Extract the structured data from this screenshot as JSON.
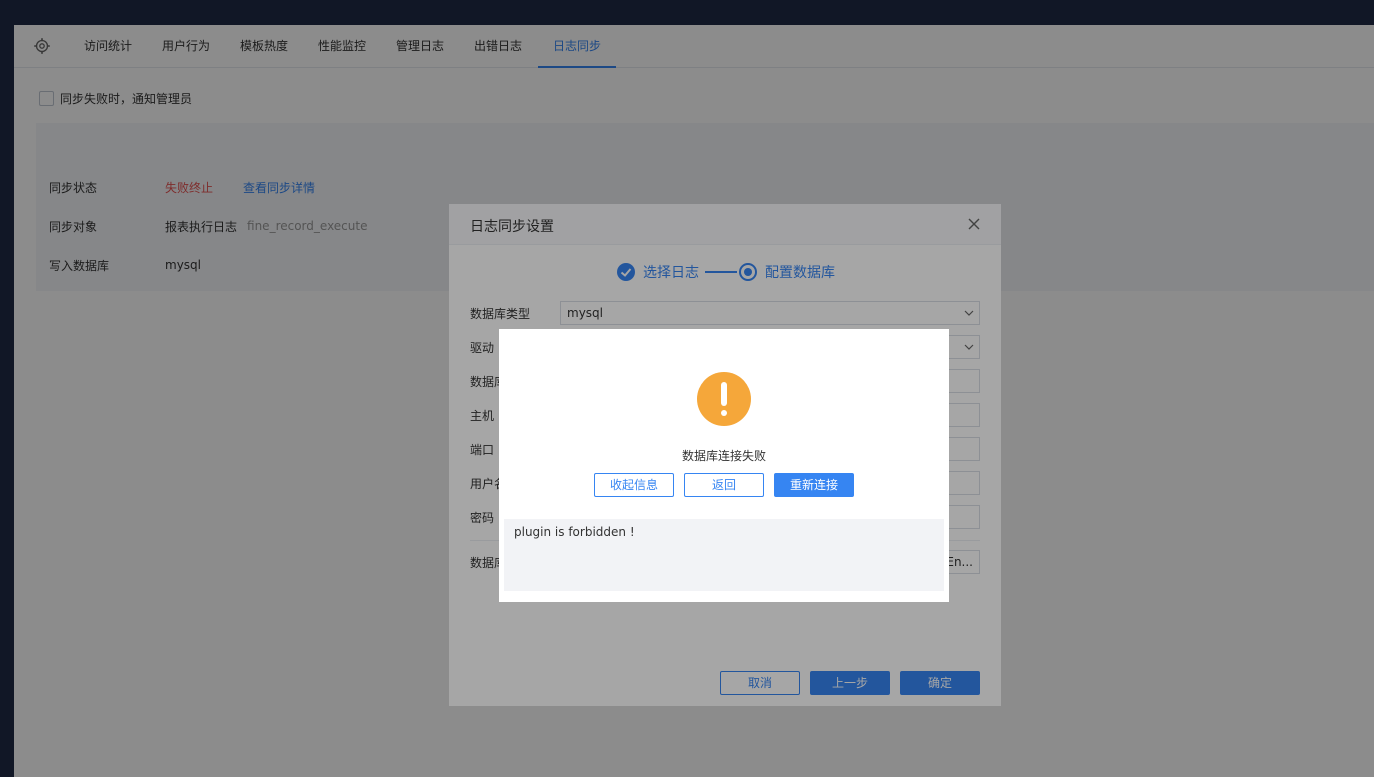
{
  "tabs": [
    "访问统计",
    "用户行为",
    "模板热度",
    "性能监控",
    "管理日志",
    "出错日志",
    "日志同步"
  ],
  "active_tab": "日志同步",
  "notify_label": "同步失败时，通知管理员",
  "status_rows": {
    "status_label": "同步状态",
    "status_value": "失败终止",
    "status_link": "查看同步详情",
    "object_label": "同步对象",
    "object_value": "报表执行日志",
    "object_table": "fine_record_execute",
    "db_label": "写入数据库",
    "db_value": "mysql"
  },
  "dialog": {
    "title": "日志同步设置",
    "step1": "选择日志",
    "step2": "配置数据库",
    "fields": {
      "db_type_label": "数据库类型",
      "db_type_value": "mysql",
      "driver_label": "驱动",
      "dbname_label": "数据库",
      "host_label": "主机",
      "port_label": "端口",
      "user_label": "用户名",
      "password_label": "密码",
      "dbextra_label": "数据库",
      "dbextra_value": "En..."
    },
    "cancel": "取消",
    "prev": "上一步",
    "ok": "确定"
  },
  "alert": {
    "message": "数据库连接失败",
    "collapse": "收起信息",
    "back": "返回",
    "reconnect": "重新连接",
    "detail": "plugin is forbidden !"
  },
  "colors": {
    "accent": "#3685f2",
    "danger": "#e65251",
    "warning": "#f5a73a"
  }
}
